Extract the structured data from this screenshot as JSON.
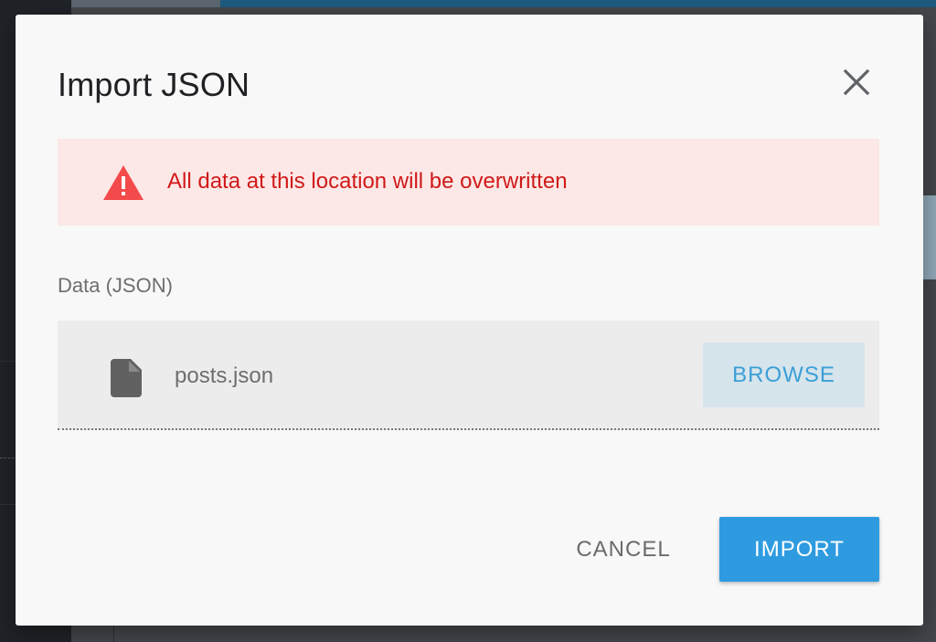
{
  "dialog": {
    "title": "Import JSON",
    "close_icon": "close-icon",
    "alert": {
      "icon": "warning-icon",
      "text": "All data at this location will be overwritten",
      "color": "#d01919",
      "background": "#fce8e6"
    },
    "field": {
      "label": "Data (JSON)",
      "file_icon": "file-icon",
      "file_name": "posts.json",
      "browse_label": "BROWSE"
    },
    "actions": {
      "cancel_label": "CANCEL",
      "import_label": "IMPORT",
      "accent_color": "#2e9be0"
    }
  }
}
